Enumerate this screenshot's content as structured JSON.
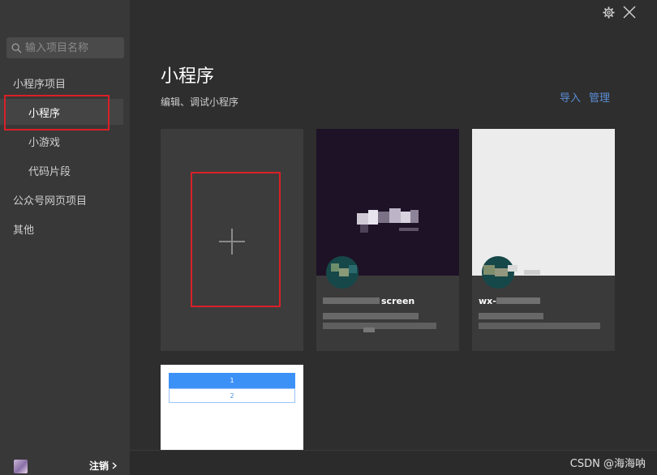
{
  "sidebar": {
    "search_placeholder": "输入项目名称",
    "items": [
      {
        "label": "小程序项目"
      },
      {
        "label": "小程序"
      },
      {
        "label": "小游戏"
      },
      {
        "label": "代码片段"
      },
      {
        "label": "公众号网页项目"
      },
      {
        "label": "其他"
      }
    ],
    "logout_label": "注销"
  },
  "main": {
    "title": "小程序",
    "subtitle": "编辑、调试小程序",
    "import_label": "导入",
    "manage_label": "管理",
    "projects": [
      {
        "name": "screen"
      },
      {
        "name": "wx-"
      }
    ],
    "demo_rows": [
      "1",
      "2"
    ]
  },
  "watermark": "CSDN @海海呐",
  "colors": {
    "accent": "#5b8ed6",
    "highlight": "#d92027",
    "demo_blue": "#3c91f7"
  }
}
